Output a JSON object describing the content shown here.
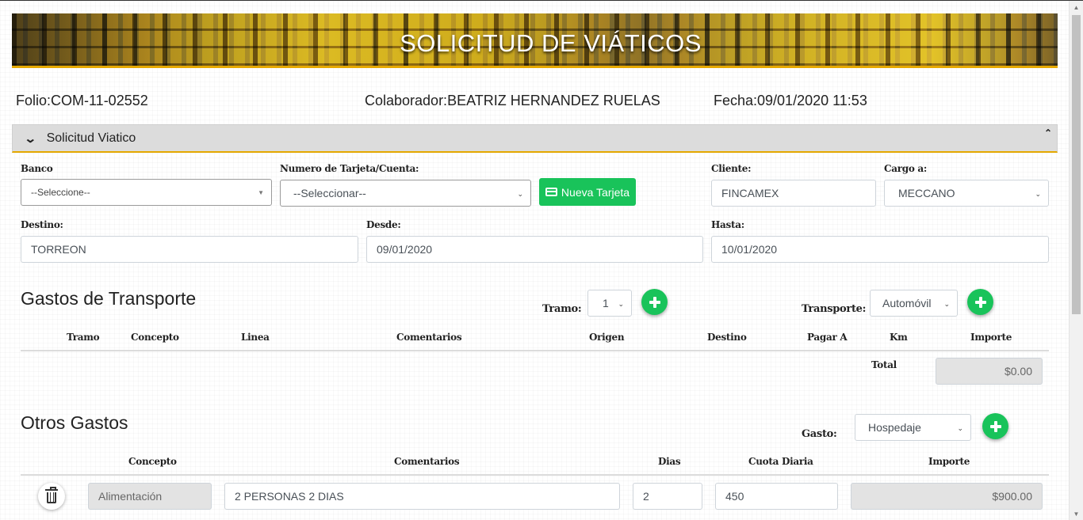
{
  "banner": {
    "title": "SOLICITUD DE VIÁTICOS"
  },
  "info": {
    "folio": "Folio:COM-11-02552",
    "colaborador": "Colaborador:BEATRIZ HERNANDEZ RUELAS",
    "fecha": "Fecha:09/01/2020 11:53"
  },
  "panel": {
    "title": "Solicitud Viatico"
  },
  "form": {
    "banco_label": "Banco",
    "banco_value": "--Seleccione--",
    "tarjeta_label": "Numero de Tarjeta/Cuenta:",
    "tarjeta_value": "--Seleccionar--",
    "nueva_tarjeta": "Nueva Tarjeta",
    "cliente_label": "Cliente:",
    "cliente_value": "FINCAMEX",
    "cargo_label": "Cargo a:",
    "cargo_value": "MECCANO",
    "destino_label": "Destino:",
    "destino_value": "TORREON",
    "desde_label": "Desde:",
    "desde_value": "09/01/2020",
    "hasta_label": "Hasta:",
    "hasta_value": "10/01/2020"
  },
  "transporte": {
    "title": "Gastos de Transporte",
    "tramo_label": "Tramo:",
    "tramo_value": "1",
    "transporte_label": "Transporte:",
    "transporte_value": "Automóvil",
    "columns": [
      "Tramo",
      "Concepto",
      "Linea",
      "Comentarios",
      "Origen",
      "Destino",
      "Pagar A",
      "Km",
      "Importe"
    ],
    "total_label": "Total",
    "total_value": "$0.00"
  },
  "otros": {
    "title": "Otros Gastos",
    "gasto_label": "Gasto:",
    "gasto_value": "Hospedaje",
    "columns": [
      "Concepto",
      "Comentarios",
      "Dias",
      "Cuota Diaria",
      "Importe"
    ],
    "rows": [
      {
        "concepto": "Alimentación",
        "comentarios": "2 PERSONAS 2 DIAS",
        "dias": "2",
        "cuota": "450",
        "importe": "$900.00"
      }
    ]
  },
  "colors": {
    "accent": "#e5a800",
    "success": "#19c35a"
  },
  "icons": [
    "chevron-down-icon",
    "chevron-up-icon",
    "credit-card-icon",
    "plus-icon",
    "trash-icon",
    "caret-down-icon"
  ]
}
